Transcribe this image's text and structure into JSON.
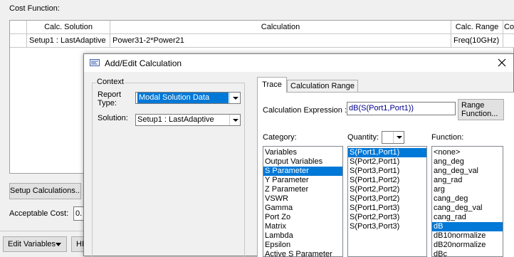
{
  "background_window": {
    "cost_function_label": "Cost Function:",
    "table": {
      "headers": [
        "Calc. Solution",
        "Calculation",
        "Calc. Range",
        "Co"
      ],
      "rows": [
        {
          "solution": "Setup1 : LastAdaptive",
          "calculation": "Power31-2*Power21",
          "range": "Freq(10GHz)"
        }
      ]
    },
    "setup_calculations_label": "Setup Calculations...",
    "acceptable_cost_label": "Acceptable Cost:",
    "acceptable_cost_value": "0.",
    "edit_variables_label": "Edit Variables",
    "hi_label": "HI"
  },
  "dialog": {
    "title": "Add/Edit Calculation",
    "context": {
      "group_label": "Context",
      "report_type_label": "Report\nType:",
      "report_type_value": "Modal Solution Data",
      "solution_label": "Solution:",
      "solution_value": "Setup1 : LastAdaptive"
    },
    "tabs": [
      {
        "label": "Trace",
        "active": true
      },
      {
        "label": "Calculation Range",
        "active": false
      }
    ],
    "calc_expression_label": "Calculation Expression :",
    "calc_expression_value": "dB(S(Port1,Port1))",
    "range_function_label": "Range\nFunction...",
    "category_label": "Category:",
    "quantity_label": "Quantity:",
    "function_label": "Function:",
    "category_items": [
      {
        "label": "Variables",
        "selected": false
      },
      {
        "label": "Output Variables",
        "selected": false
      },
      {
        "label": "S Parameter",
        "selected": true
      },
      {
        "label": "Y Parameter",
        "selected": false
      },
      {
        "label": "Z Parameter",
        "selected": false
      },
      {
        "label": "VSWR",
        "selected": false
      },
      {
        "label": "Gamma",
        "selected": false
      },
      {
        "label": "Port Zo",
        "selected": false
      },
      {
        "label": "Matrix",
        "selected": false
      },
      {
        "label": "Lambda",
        "selected": false
      },
      {
        "label": "Epsilon",
        "selected": false
      },
      {
        "label": "Active S Parameter",
        "selected": false
      }
    ],
    "quantity_items": [
      {
        "label": "S(Port1,Port1)",
        "selected": true
      },
      {
        "label": "S(Port2,Port1)",
        "selected": false
      },
      {
        "label": "S(Port3,Port1)",
        "selected": false
      },
      {
        "label": "S(Port1,Port2)",
        "selected": false
      },
      {
        "label": "S(Port2,Port2)",
        "selected": false
      },
      {
        "label": "S(Port3,Port2)",
        "selected": false
      },
      {
        "label": "S(Port1,Port3)",
        "selected": false
      },
      {
        "label": "S(Port2,Port3)",
        "selected": false
      },
      {
        "label": "S(Port3,Port3)",
        "selected": false
      }
    ],
    "function_items": [
      {
        "label": "<none>",
        "selected": false
      },
      {
        "label": "ang_deg",
        "selected": false
      },
      {
        "label": "ang_deg_val",
        "selected": false
      },
      {
        "label": "ang_rad",
        "selected": false
      },
      {
        "label": "arg",
        "selected": false
      },
      {
        "label": "cang_deg",
        "selected": false
      },
      {
        "label": "cang_deg_val",
        "selected": false
      },
      {
        "label": "cang_rad",
        "selected": false
      },
      {
        "label": "dB",
        "selected": true
      },
      {
        "label": "dB10normalize",
        "selected": false
      },
      {
        "label": "dB20normalize",
        "selected": false
      },
      {
        "label": "dBc",
        "selected": false
      }
    ]
  },
  "colors": {
    "selection": "#0078d7",
    "window_bg": "#f0f0f0",
    "expression_text": "#00008b"
  },
  "icons": [
    "dialog-app-icon",
    "close-icon",
    "dropdown-arrow-icon"
  ]
}
